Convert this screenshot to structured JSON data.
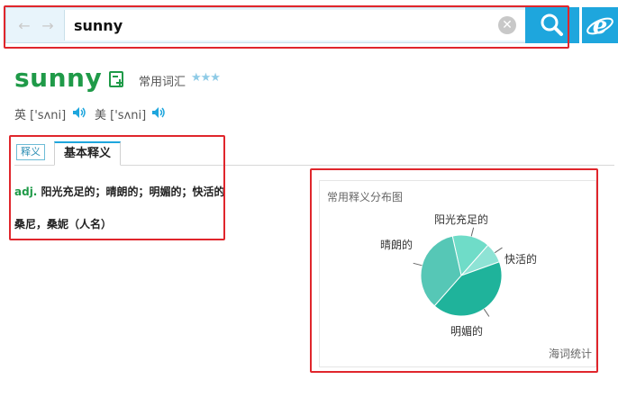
{
  "search": {
    "query": "sunny",
    "back_icon": "arrow-left-icon",
    "forward_icon": "arrow-right-icon",
    "clear_icon": "clear-icon",
    "search_icon": "magnifier-icon",
    "browser_icon": "ie-browser-icon"
  },
  "entry": {
    "word": "sunny",
    "vocab_label": "常用词汇",
    "stars": "★★★",
    "pronunciations": [
      {
        "region": "英",
        "ipa": "['sʌni]"
      },
      {
        "region": "美",
        "ipa": "['sʌni]"
      }
    ]
  },
  "tabs": {
    "items": [
      {
        "label": "释义"
      },
      {
        "label": "基本释义"
      }
    ]
  },
  "definitions": {
    "pos": "adj.",
    "meaning": "阳光充足的；晴朗的；明媚的；快活的",
    "name_meaning": "桑尼，桑妮（人名）"
  },
  "chart_data": {
    "type": "pie",
    "title": "常用释义分布图",
    "categories": [
      "阳光充足的",
      "快活的",
      "明媚的",
      "晴朗的"
    ],
    "values": [
      15,
      8,
      42,
      35
    ],
    "colors": [
      "#6fdcc8",
      "#8ee3d5",
      "#1fb39b",
      "#56c7b6"
    ],
    "footer": "海词统计"
  },
  "colors": {
    "accent": "#1ea6dd",
    "word_green": "#1f9a48",
    "highlight_red": "#e0262c"
  }
}
